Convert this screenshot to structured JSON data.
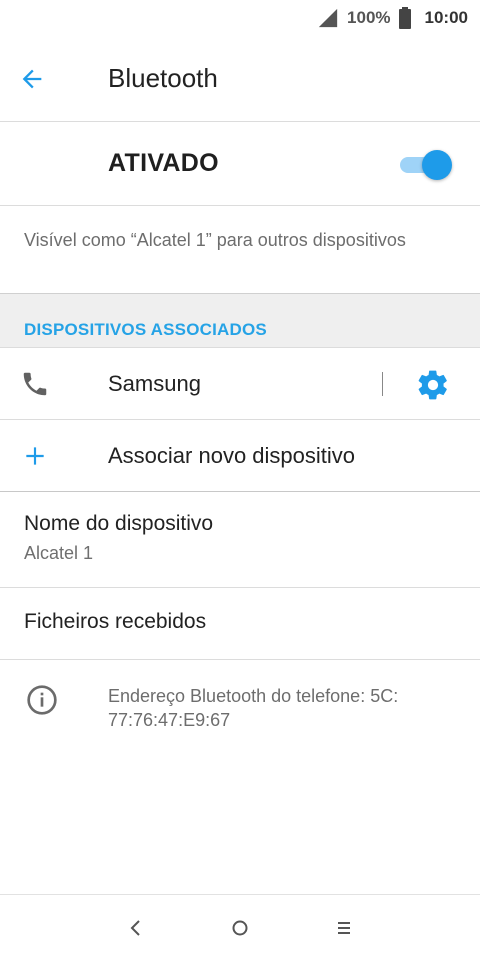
{
  "status_bar": {
    "battery_percent": "100%",
    "time": "10:00"
  },
  "header": {
    "title": "Bluetooth"
  },
  "bluetooth_switch": {
    "label": "ATIVADO",
    "enabled": true,
    "accent_color": "#1e9be9"
  },
  "visibility_text": "Visível como “Alcatel 1” para outros dispositivos",
  "paired_section": {
    "header": "DISPOSITIVOS ASSOCIADOS",
    "devices": [
      {
        "name": "Samsung",
        "icon": "phone-icon",
        "settings_icon": "gear-icon"
      }
    ]
  },
  "pair_new": {
    "label": "Associar novo dispositivo",
    "icon": "plus-icon"
  },
  "device_name": {
    "title": "Nome do dispositivo",
    "value": "Alcatel 1"
  },
  "received_files": {
    "label": "Ficheiros recebidos"
  },
  "address_info": {
    "icon": "info-icon",
    "text": "Endereço Bluetooth do telefone: 5C:\n77:76:47:E9:67"
  },
  "nav_bar": {
    "buttons": [
      "back-icon",
      "home-icon",
      "recents-icon"
    ]
  }
}
